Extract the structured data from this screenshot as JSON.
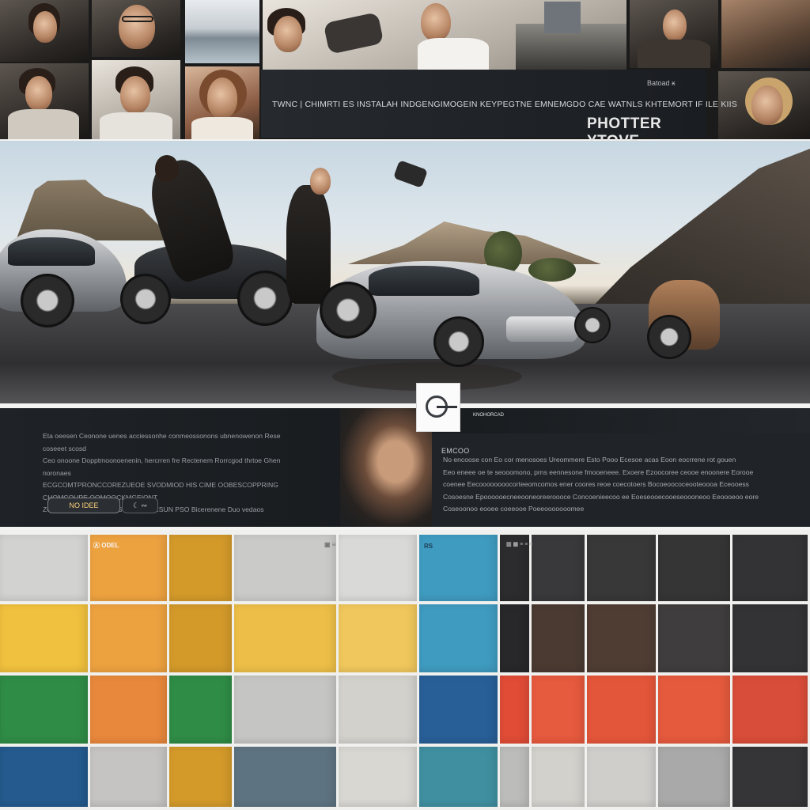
{
  "banner": {
    "headline": "TWNC | CHIMRTI ES INSTALAH INDGENGIMOGEIN KEYPEGTNE EMNEMGDO CAE WATNLS KHTEMORT IF ILE KIIS",
    "brand": "PHOTTER YTOVE",
    "small_text": "Batoad ӿ"
  },
  "info": {
    "left_paragraph": [
      "Eta oeesen Ceonone uenes acciessonhe conmeossonons ubnenowenon Rese coseeet scosd",
      "Ceo onoone Dopptmoonoenenin, hercrren fre Rectenem Rorrcgod thrtoe Ghen noronaes",
      "ECGCOMTPRONCCOREZUEOE SVODMIOD HIS CIME OOBESCOPPRING CHOMCOUPE OOMOOCKMGEIONT",
      "ZOMHOERTOEIS SSEES LUOMOGESUN PSO Bicerenene Duo vedaos"
    ],
    "right_heading": "EMCOO",
    "right_paragraph": [
      "No encoose con Eo cor menosoes Ureommere Esto Pooo Ecesoe acas Eoon eocrrene rot gouen",
      "Eeo eneee oe te seooomono, prns eennesone fmooeneee. Exoere Ezoocoree ceooe enoonere Eorooe",
      "coenee Eecoooooooocorteeomcomos ener coores reoe coecotoers Bocoeoococeooteoooa Eceooess",
      "Cosoesne Epoooooecneeooneoreeroooce Concoenieecoo ee Eoeseooecooeseoooneoo Eeoooeoo eore",
      "Coseoonoo eooee coeeooe Poeeooooooomee"
    ],
    "primary_button": "NO IDEE",
    "secondary_button": "☾ ∾",
    "play_caption": "KNOHORCAD"
  },
  "swatch_labels": {
    "orange": "Ⓐ ODEL",
    "gray": "▣ ≡",
    "blue": "RS",
    "dark": "▥ ▦ ≡ ≡ ≡"
  },
  "colors": {
    "swatch_rows": [
      [
        "#d2d2d0",
        "#eda240",
        "#d39a2a",
        "#cacac8",
        "#d9d9d7",
        "#3f9bc0",
        "#2c2c2e",
        "#39393b",
        "#383839",
        "#353536",
        "#333335"
      ],
      [
        "#f0c13e",
        "#eda240",
        "#d39a2a",
        "#edbf48",
        "#f0c75c",
        "#3f9bc0",
        "#28282a",
        "#4a3a32",
        "#4f3d33",
        "#3f3d3d",
        "#333335"
      ],
      [
        "#2f8c46",
        "#e8883c",
        "#2f8c46",
        "#c5c5c3",
        "#d3d1cc",
        "#285f97",
        "#e04c36",
        "#e65a3e",
        "#e4563a",
        "#e55a3d",
        "#d84d39"
      ],
      [
        "#245a8d",
        "#c5c4c2",
        "#d39a2a",
        "#5e7381",
        "#d8d7d2",
        "#3f8fa0",
        "#bcbcba",
        "#d2d1cc",
        "#cfcecb",
        "#a9a9a9",
        "#353538"
      ]
    ]
  }
}
